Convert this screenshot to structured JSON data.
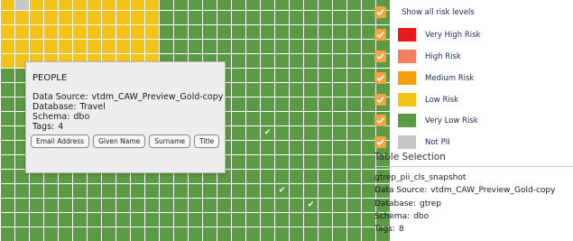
{
  "colors": {
    "grid_green": "#5a9a43",
    "grid_yellow": "#f4c318",
    "grid_gray": "#c8c8c8",
    "checkbox_orange": "#f5a340"
  },
  "grid": {
    "rows": 17,
    "cols": 27,
    "yellow_region": {
      "rows": 5,
      "cols": 11
    },
    "gray_cells": [
      [
        0,
        1
      ]
    ],
    "checked_cells": [
      [
        9,
        18
      ],
      [
        13,
        19
      ],
      [
        14,
        21
      ]
    ],
    "check_glyph": "✔"
  },
  "popup": {
    "title": "PEOPLE",
    "data_source_label": "Data Source:",
    "data_source": "vtdm_CAW_Preview_Gold-copy",
    "database_label": "Database:",
    "database": "Travel",
    "schema_label": "Schema:",
    "schema": "dbo",
    "tags_label": "Tags:",
    "tags_count": "4",
    "tags": [
      "Email Address",
      "Given Name",
      "Surname",
      "Title"
    ]
  },
  "legend": {
    "show_all_label": "Show all risk levels",
    "items": [
      {
        "label": "Very High Risk",
        "color": "#e8191a"
      },
      {
        "label": "High Risk",
        "color": "#f37f63"
      },
      {
        "label": "Medium Risk",
        "color": "#f5a00d"
      },
      {
        "label": "Low Risk",
        "color": "#f4c318"
      },
      {
        "label": "Very Low Risk",
        "color": "#5a9a43"
      },
      {
        "label": "Not PII",
        "color": "#c8c8c8"
      }
    ]
  },
  "table_selection": {
    "title": "Table Selection",
    "name": "gtrep_pii_cls_snapshot",
    "data_source_label": "Data Source:",
    "data_source": "vtdm_CAW_Preview_Gold-copy",
    "database_label": "Database:",
    "database": "gtrep",
    "schema_label": "Schema:",
    "schema": "dbo",
    "tags_label": "Tags:",
    "tags_count": "8"
  }
}
